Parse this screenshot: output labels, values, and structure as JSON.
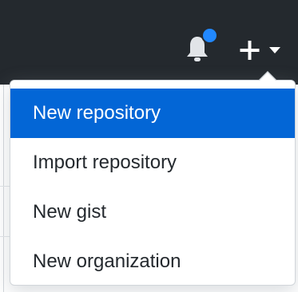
{
  "header": {
    "notifications_icon": "bell-icon",
    "notification_dot_color": "#2188ff",
    "create_icon": "plus-icon",
    "create_caret_icon": "caret-down-icon",
    "background_color": "#24292e"
  },
  "dropdown": {
    "items": [
      {
        "label": "New repository",
        "active": true
      },
      {
        "label": "Import repository",
        "active": false
      },
      {
        "label": "New gist",
        "active": false
      },
      {
        "label": "New organization",
        "active": false
      }
    ],
    "active_color": "#0366d6"
  }
}
